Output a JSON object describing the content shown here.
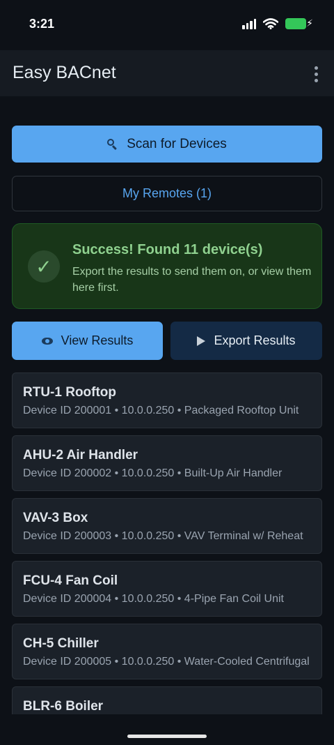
{
  "status_bar": {
    "time": "3:21"
  },
  "app_bar": {
    "title": "Easy BACnet",
    "menu_icon": "more-vertical-icon"
  },
  "actions": {
    "scan_label": "Scan for Devices",
    "remotes_label": "My Remotes (1)"
  },
  "banner": {
    "title": "Success! Found 11 device(s)",
    "body": "Export the results to send them on, or view them here first.",
    "icon": "check-icon",
    "check_glyph": "✓"
  },
  "results": {
    "view_label": "View Results",
    "export_label": "Export Results"
  },
  "devices": [
    {
      "name": "RTU-1 Rooftop",
      "meta": "Device ID 200001 • 10.0.0.250 • Packaged Rooftop Unit"
    },
    {
      "name": "AHU-2 Air Handler",
      "meta": "Device ID 200002 • 10.0.0.250 • Built-Up Air Handler"
    },
    {
      "name": "VAV-3 Box",
      "meta": "Device ID 200003 • 10.0.0.250 • VAV Terminal w/ Reheat"
    },
    {
      "name": "FCU-4 Fan Coil",
      "meta": "Device ID 200004 • 10.0.0.250 • 4-Pipe Fan Coil Unit"
    },
    {
      "name": "CH-5 Chiller",
      "meta": "Device ID 200005 • 10.0.0.250 • Water-Cooled Centrifugal"
    },
    {
      "name": "BLR-6 Boiler",
      "meta": ""
    }
  ],
  "colors": {
    "accent": "#58a6f0",
    "success": "#8fd18f",
    "background": "#0d1117",
    "battery": "#34c759"
  }
}
